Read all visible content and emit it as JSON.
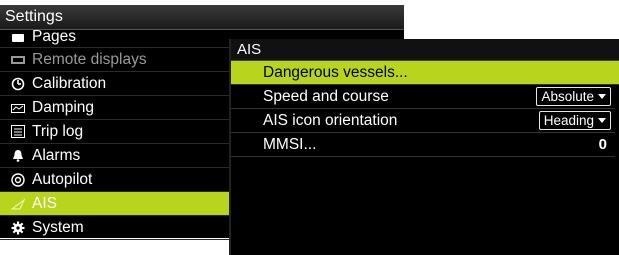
{
  "settings": {
    "title": "Settings",
    "items": [
      {
        "label": "Pages",
        "icon": "pages-icon"
      },
      {
        "label": "Remote displays",
        "icon": "remote-displays-icon"
      },
      {
        "label": "Calibration",
        "icon": "calibration-icon"
      },
      {
        "label": "Damping",
        "icon": "damping-icon"
      },
      {
        "label": "Trip log",
        "icon": "trip-log-icon"
      },
      {
        "label": "Alarms",
        "icon": "alarm-bell-icon"
      },
      {
        "label": "Autopilot",
        "icon": "autopilot-icon"
      },
      {
        "label": "AIS",
        "icon": "ais-icon"
      },
      {
        "label": "System",
        "icon": "gear-icon"
      }
    ],
    "selected": "AIS"
  },
  "ais": {
    "title": "AIS",
    "rows": [
      {
        "label": "Dangerous vessels..."
      },
      {
        "label": "Speed and course",
        "value": "Absolute"
      },
      {
        "label": "AIS icon orientation",
        "value": "Heading"
      },
      {
        "label": "MMSI...",
        "value": "0"
      }
    ]
  },
  "colors": {
    "accent": "#b8d41c",
    "background": "#000000",
    "text": "#ffffff"
  }
}
